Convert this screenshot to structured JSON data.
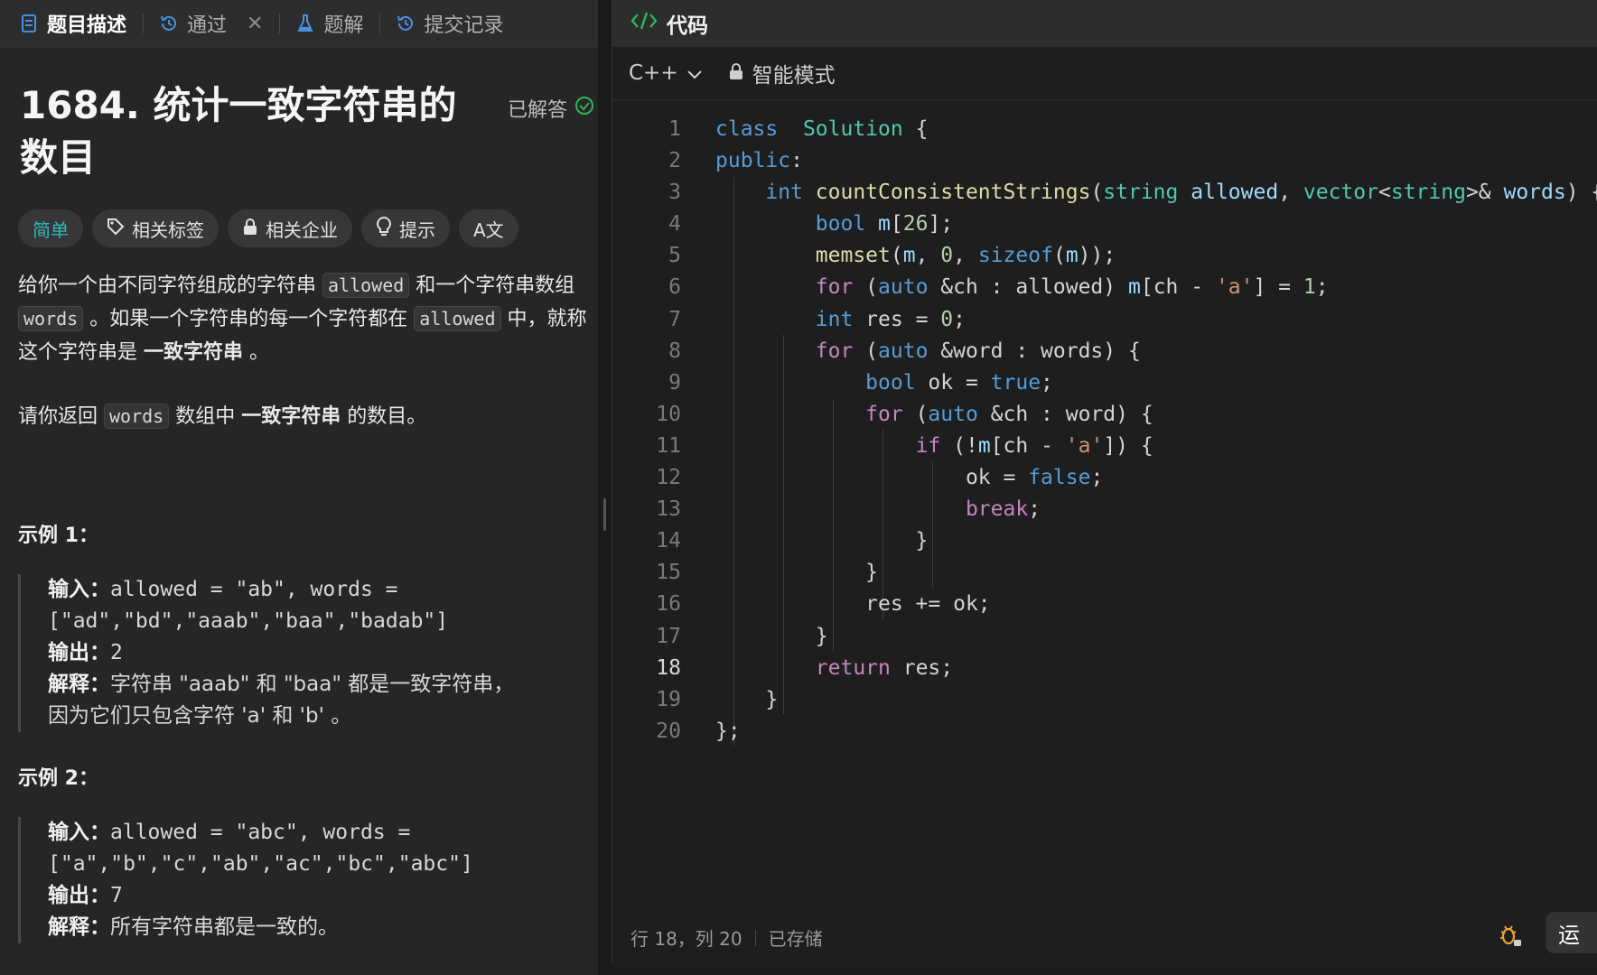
{
  "tabs": [
    {
      "label": "题目描述",
      "icon": "document-icon",
      "active": true
    },
    {
      "label": "通过",
      "icon": "history-icon",
      "closable": true
    },
    {
      "label": "题解",
      "icon": "flask-icon"
    },
    {
      "label": "提交记录",
      "icon": "history-icon"
    }
  ],
  "problem": {
    "title": "1684. 统计一致字符串的数目",
    "status": "已解答",
    "tags": [
      "简单",
      "相关标签",
      "相关企业",
      "提示",
      "A文"
    ],
    "desc1_a": "给你一个由不同字符组成的字符串 ",
    "desc1_code1": "allowed",
    "desc1_b": " 和一个字符串数组 ",
    "desc1_code2": "words",
    "desc1_c": " 。如果一个字符串的每一个字符都在 ",
    "desc1_code3": "allowed",
    "desc1_d": " 中，就称这个字符串是 ",
    "desc1_bold": "一致字符串",
    "desc1_e": " 。",
    "desc2_a": "请你返回 ",
    "desc2_code": "words",
    "desc2_b": " 数组中 ",
    "desc2_bold": "一致字符串",
    "desc2_c": " 的数目。"
  },
  "examples": [
    {
      "title": "示例 1：",
      "input_label": "输入：",
      "input_1": "allowed = \"ab\", words =",
      "input_2": "[\"ad\",\"bd\",\"aaab\",\"baa\",\"badab\"]",
      "output_label": "输出：",
      "output": "2",
      "explain_label": "解释：",
      "explain_1": "字符串 \"aaab\" 和 \"baa\" 都是一致字符串，",
      "explain_2": "因为它们只包含字符 'a' 和 'b' 。"
    },
    {
      "title": "示例 2：",
      "input_label": "输入：",
      "input_1": "allowed = \"abc\", words =",
      "input_2": "[\"a\",\"b\",\"c\",\"ab\",\"ac\",\"bc\",\"abc\"]",
      "output_label": "输出：",
      "output": "7",
      "explain_label": "解释：",
      "explain_1": "所有字符串都是一致的。"
    }
  ],
  "editor": {
    "header_title": "代码",
    "language": "C++",
    "mode": "智能模式",
    "current_line": 18,
    "status_position": "行 18，列 20",
    "status_saved": "已存储",
    "run_label": "运"
  },
  "code_lines": [
    [
      [
        "kw",
        "class"
      ],
      [
        "",
        "  "
      ],
      [
        "ty",
        "Solution"
      ],
      [
        "",
        " {"
      ]
    ],
    [
      [
        "kw",
        "public"
      ],
      [
        "",
        ":"
      ]
    ],
    [
      [
        "",
        "    "
      ],
      [
        "kw",
        "int"
      ],
      [
        "",
        " "
      ],
      [
        "fn",
        "countConsistentStrings"
      ],
      [
        "",
        "("
      ],
      [
        "ty",
        "string"
      ],
      [
        "",
        " "
      ],
      [
        "va",
        "allowed"
      ],
      [
        "",
        ", "
      ],
      [
        "ty",
        "vector"
      ],
      [
        "",
        "<"
      ],
      [
        "ty",
        "string"
      ],
      [
        "",
        "&gt;&amp; "
      ],
      [
        "va",
        "words"
      ],
      [
        "",
        ") {"
      ]
    ],
    [
      [
        "",
        "        "
      ],
      [
        "kw",
        "bool"
      ],
      [
        "",
        " "
      ],
      [
        "va",
        "m"
      ],
      [
        "",
        "["
      ],
      [
        "nu",
        "26"
      ],
      [
        "",
        "];"
      ]
    ],
    [
      [
        "",
        "        "
      ],
      [
        "fn",
        "memset"
      ],
      [
        "",
        "("
      ],
      [
        "va",
        "m"
      ],
      [
        "",
        ", "
      ],
      [
        "nu",
        "0"
      ],
      [
        "",
        ", "
      ],
      [
        "kw",
        "sizeof"
      ],
      [
        "",
        "("
      ],
      [
        "va",
        "m"
      ],
      [
        "",
        "));"
      ]
    ],
    [
      [
        "",
        "        "
      ],
      [
        "kw2",
        "for"
      ],
      [
        "",
        " ("
      ],
      [
        "kw",
        "auto"
      ],
      [
        "",
        " &amp;ch : allowed) "
      ],
      [
        "va",
        "m"
      ],
      [
        "",
        "[ch - "
      ],
      [
        "st",
        "'a'"
      ],
      [
        "",
        "] = "
      ],
      [
        "nu",
        "1"
      ],
      [
        "",
        ";"
      ]
    ],
    [
      [
        "",
        "        "
      ],
      [
        "kw",
        "int"
      ],
      [
        "",
        " res = "
      ],
      [
        "nu",
        "0"
      ],
      [
        "",
        ";"
      ]
    ],
    [
      [
        "",
        "        "
      ],
      [
        "kw2",
        "for"
      ],
      [
        "",
        " ("
      ],
      [
        "kw",
        "auto"
      ],
      [
        "",
        " &amp;word : words) {"
      ]
    ],
    [
      [
        "",
        "            "
      ],
      [
        "kw",
        "bool"
      ],
      [
        "",
        " ok = "
      ],
      [
        "kw",
        "true"
      ],
      [
        "",
        ";"
      ]
    ],
    [
      [
        "",
        "            "
      ],
      [
        "kw2",
        "for"
      ],
      [
        "",
        " ("
      ],
      [
        "kw",
        "auto"
      ],
      [
        "",
        " &amp;ch : word) {"
      ]
    ],
    [
      [
        "",
        "                "
      ],
      [
        "kw2",
        "if"
      ],
      [
        "",
        " (!"
      ],
      [
        "va",
        "m"
      ],
      [
        "",
        "[ch - "
      ],
      [
        "st",
        "'a'"
      ],
      [
        "",
        "]) {"
      ]
    ],
    [
      [
        "",
        "                    ok = "
      ],
      [
        "kw",
        "false"
      ],
      [
        "",
        ";"
      ]
    ],
    [
      [
        "",
        "                    "
      ],
      [
        "kw2",
        "break"
      ],
      [
        "",
        ";"
      ]
    ],
    [
      [
        "",
        "                }"
      ]
    ],
    [
      [
        "",
        "            }"
      ]
    ],
    [
      [
        "",
        "            res += ok;"
      ]
    ],
    [
      [
        "",
        "        }"
      ]
    ],
    [
      [
        "",
        "        "
      ],
      [
        "kw2",
        "return"
      ],
      [
        "",
        " res;"
      ]
    ],
    [
      [
        "",
        "    }"
      ]
    ],
    [
      [
        "",
        "};"
      ]
    ]
  ]
}
